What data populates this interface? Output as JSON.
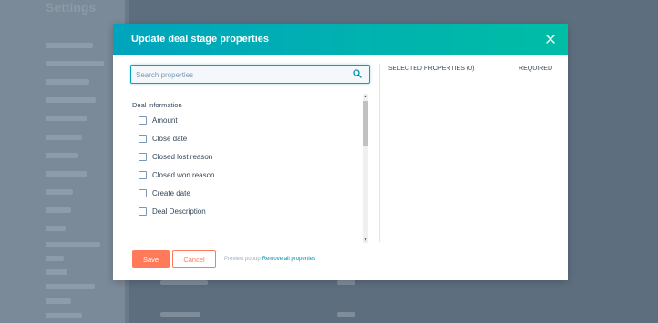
{
  "background": {
    "title": "Settings"
  },
  "modal": {
    "title": "Update deal stage properties",
    "search": {
      "placeholder": "Search properties",
      "value": ""
    },
    "group_label": "Deal information",
    "properties": [
      {
        "label": "Amount",
        "checked": false
      },
      {
        "label": "Close date",
        "checked": false
      },
      {
        "label": "Closed lost reason",
        "checked": false
      },
      {
        "label": "Closed won reason",
        "checked": false
      },
      {
        "label": "Create date",
        "checked": false
      },
      {
        "label": "Deal Description",
        "checked": false
      }
    ],
    "selected_header": "SELECTED PROPERTIES (0)",
    "required_header": "REQUIRED",
    "footer": {
      "save_label": "Save",
      "cancel_label": "Cancel",
      "preview_text": "Preview popup",
      "remove_all_label": "Remove all properties"
    }
  },
  "colors": {
    "header_start": "#00a4bd",
    "header_end": "#00bda5",
    "accent": "#ff7a59",
    "link": "#0091ae"
  },
  "icons": {
    "close": "close-icon",
    "search": "search-icon"
  }
}
